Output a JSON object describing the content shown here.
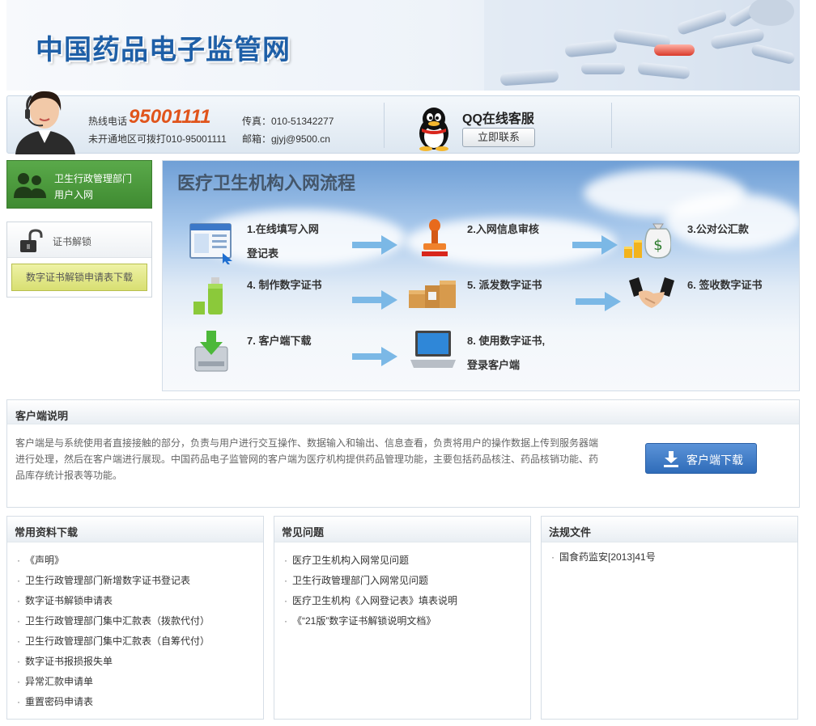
{
  "banner": {
    "title": "中国药品电子监管网"
  },
  "contact": {
    "hotline_label": "热线电话",
    "hotline_number": "95001111",
    "note": "未开通地区可拨打010-95001111",
    "fax": "传真：010-51342277",
    "email": "邮箱：gjyj@9500.cn",
    "qq_title": "QQ在线客服",
    "qq_button": "立即联系"
  },
  "sidebar": {
    "health_dept_line1": "卫生行政管理部门",
    "health_dept_line2": "用户入网",
    "cert_unlock_label": "证书解锁",
    "unlock_form_button": "数字证书解锁申请表下载"
  },
  "process": {
    "title": "医疗卫生机构入网流程",
    "steps": [
      {
        "line1": "1.在线填写入网",
        "line2": "登记表",
        "icon": "form-icon"
      },
      {
        "line1": "2.入网信息审核",
        "line2": "",
        "icon": "stamp-icon"
      },
      {
        "line1": "3.公对公汇款",
        "line2": "",
        "icon": "money-bag-icon"
      },
      {
        "line1": "4. 制作数字证书",
        "line2": "",
        "icon": "usb-key-icon"
      },
      {
        "line1": "5. 派发数字证书",
        "line2": "",
        "icon": "boxes-icon"
      },
      {
        "line1": "6. 签收数字证书",
        "line2": "",
        "icon": "handshake-icon"
      },
      {
        "line1": "7. 客户端下载",
        "line2": "",
        "icon": "download-drive-icon"
      },
      {
        "line1": "8. 使用数字证书,",
        "line2": "登录客户端",
        "icon": "laptop-icon"
      }
    ]
  },
  "client": {
    "title": "客户端说明",
    "description": "客户端是与系统使用者直接接触的部分，负责与用户进行交互操作、数据输入和输出、信息查看，负责将用户的操作数据上传到服务器端进行处理，然后在客户端进行展现。中国药品电子监管网的客户端为医疗机构提供药品管理功能，主要包括药品核注、药品核销功能、药品库存统计报表等功能。",
    "download_button": "客户端下载"
  },
  "columns": [
    {
      "title": "常用资料下载",
      "items": [
        "《声明》",
        "卫生行政管理部门新增数字证书登记表",
        "数字证书解锁申请表",
        "卫生行政管理部门集中汇款表（拨款代付）",
        "卫生行政管理部门集中汇款表（自筹代付）",
        "数字证书报损报失单",
        "异常汇款申请单",
        "重置密码申请表"
      ]
    },
    {
      "title": "常见问题",
      "items": [
        "医疗卫生机构入网常见问题",
        "卫生行政管理部门入网常见问题",
        "医疗卫生机构《入网登记表》填表说明",
        "《“21版”数字证书解锁说明文档》"
      ]
    },
    {
      "title": "法规文件",
      "items": [
        "国食药监安[2013]41号"
      ]
    }
  ],
  "colors": {
    "brand_blue": "#1e5fa7",
    "hotline_orange": "#e0541b",
    "green": "#4a9a3c",
    "button_blue": "#3d7bc8"
  }
}
